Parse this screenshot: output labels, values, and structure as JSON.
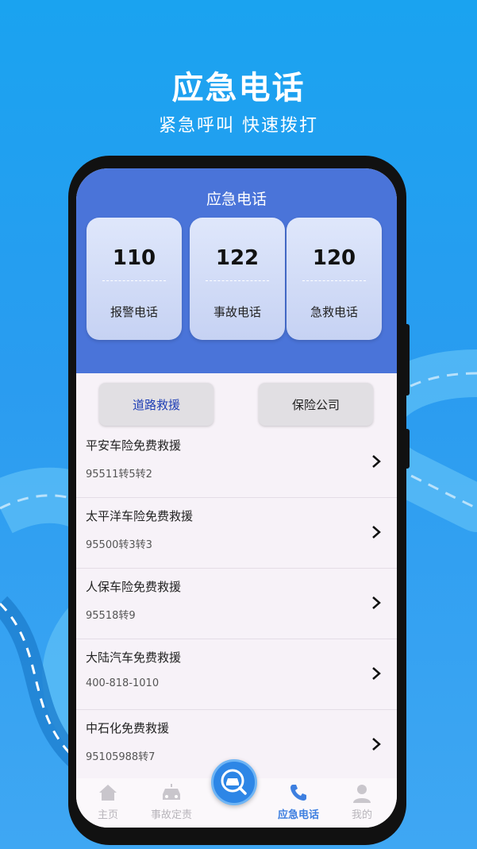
{
  "hero": {
    "title": "应急电话",
    "subtitle": "紧急呼叫 快速拨打"
  },
  "app": {
    "title": "应急电话"
  },
  "cards": [
    {
      "number": "110",
      "label": "报警电话"
    },
    {
      "number": "122",
      "label": "事故电话"
    },
    {
      "number": "120",
      "label": "急救电话"
    }
  ],
  "tabs": [
    {
      "label": "道路救援",
      "active": true
    },
    {
      "label": "保险公司",
      "active": false
    }
  ],
  "list": [
    {
      "name": "平安车险免费救援",
      "phone": "95511转5转2"
    },
    {
      "name": "太平洋车险免费救援",
      "phone": "95500转3转3"
    },
    {
      "name": "人保车险免费救援",
      "phone": "95518转9"
    },
    {
      "name": "大陆汽车免费救援",
      "phone": "400-818-1010"
    },
    {
      "name": "中石化免费救援",
      "phone": "95105988转7"
    }
  ],
  "nav": [
    {
      "label": "主页",
      "icon": "home-icon"
    },
    {
      "label": "事故定责",
      "icon": "car-accident-icon"
    },
    {
      "label": "应急电话",
      "icon": "phone-icon",
      "active": true
    },
    {
      "label": "我的",
      "icon": "user-icon"
    }
  ],
  "colors": {
    "header": "#4a74d9",
    "active_tab": "#1f3fb5",
    "active_nav": "#3d7fe0"
  }
}
